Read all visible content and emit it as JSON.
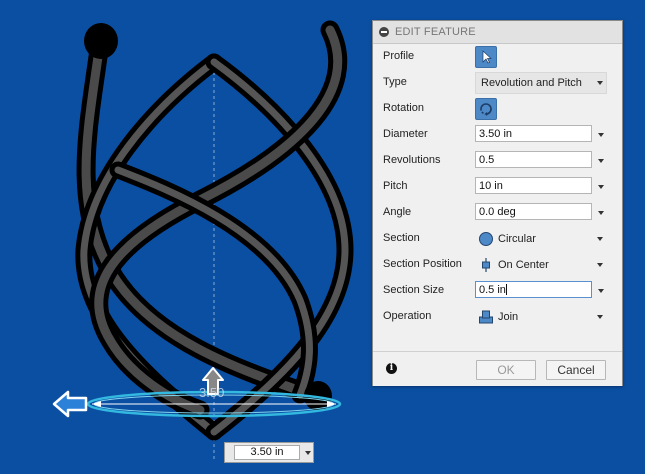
{
  "panel": {
    "title": "EDIT FEATURE",
    "rows": [
      {
        "label": "Profile"
      },
      {
        "label": "Type",
        "value": "Revolution and Pitch"
      },
      {
        "label": "Rotation"
      },
      {
        "label": "Diameter",
        "value": "3.50 in"
      },
      {
        "label": "Revolutions",
        "value": "0.5"
      },
      {
        "label": "Pitch",
        "value": "10 in"
      },
      {
        "label": "Angle",
        "value": "0.0 deg"
      },
      {
        "label": "Section",
        "value": "Circular"
      },
      {
        "label": "Section Position",
        "value": "On Center"
      },
      {
        "label": "Section Size",
        "value": "0.5 in"
      },
      {
        "label": "Operation",
        "value": "Join"
      }
    ],
    "ok_label": "OK",
    "cancel_label": "Cancel",
    "info_glyph": "i"
  },
  "canvas": {
    "dimension_value": "3.50 in",
    "diameter_label": "3.50"
  },
  "colors": {
    "background": "#0b4fa3",
    "accent": "#4d88c7",
    "manipulator": "#33b8e0"
  }
}
